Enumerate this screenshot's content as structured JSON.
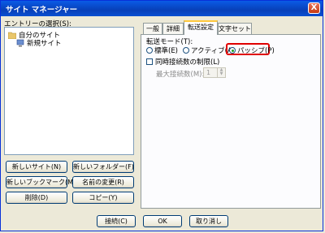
{
  "window": {
    "title": "サイト マネージャー",
    "close_glyph": "X"
  },
  "left": {
    "select_label": "エントリーの選択(S):",
    "tree": [
      {
        "label": "自分のサイト",
        "icon": "folder-icon"
      },
      {
        "label": "新規サイト",
        "icon": "computer-icon"
      }
    ],
    "buttons": {
      "new_site": "新しいサイト(N)",
      "new_folder": "新しいフォルダー(F)",
      "new_bookmark": "新しいブックマーク(M)",
      "rename": "名前の変更(R)",
      "delete": "削除(D)",
      "copy": "コピー(Y)"
    }
  },
  "tabs": [
    {
      "label": "一般"
    },
    {
      "label": "詳細"
    },
    {
      "label": "転送設定",
      "active": true
    },
    {
      "label": "文字セット"
    }
  ],
  "transfer": {
    "mode_label": "転送モード(T):",
    "modes": [
      {
        "label": "標準(E)",
        "checked": false
      },
      {
        "label": "アクティブ(A)",
        "checked": false
      },
      {
        "label": "パッシブ(P)",
        "checked": true
      }
    ],
    "limit_label": "同時接続数の制限(L)",
    "limit_checked": false,
    "max_label": "最大接続数(M):",
    "max_value": "1"
  },
  "footer": {
    "connect": "接続(C)",
    "ok": "OK",
    "cancel": "取り消し"
  },
  "colors": {
    "highlight": "#e00000",
    "titlebar": "#0a5be6",
    "active_tab_accent": "#ffc83c"
  }
}
